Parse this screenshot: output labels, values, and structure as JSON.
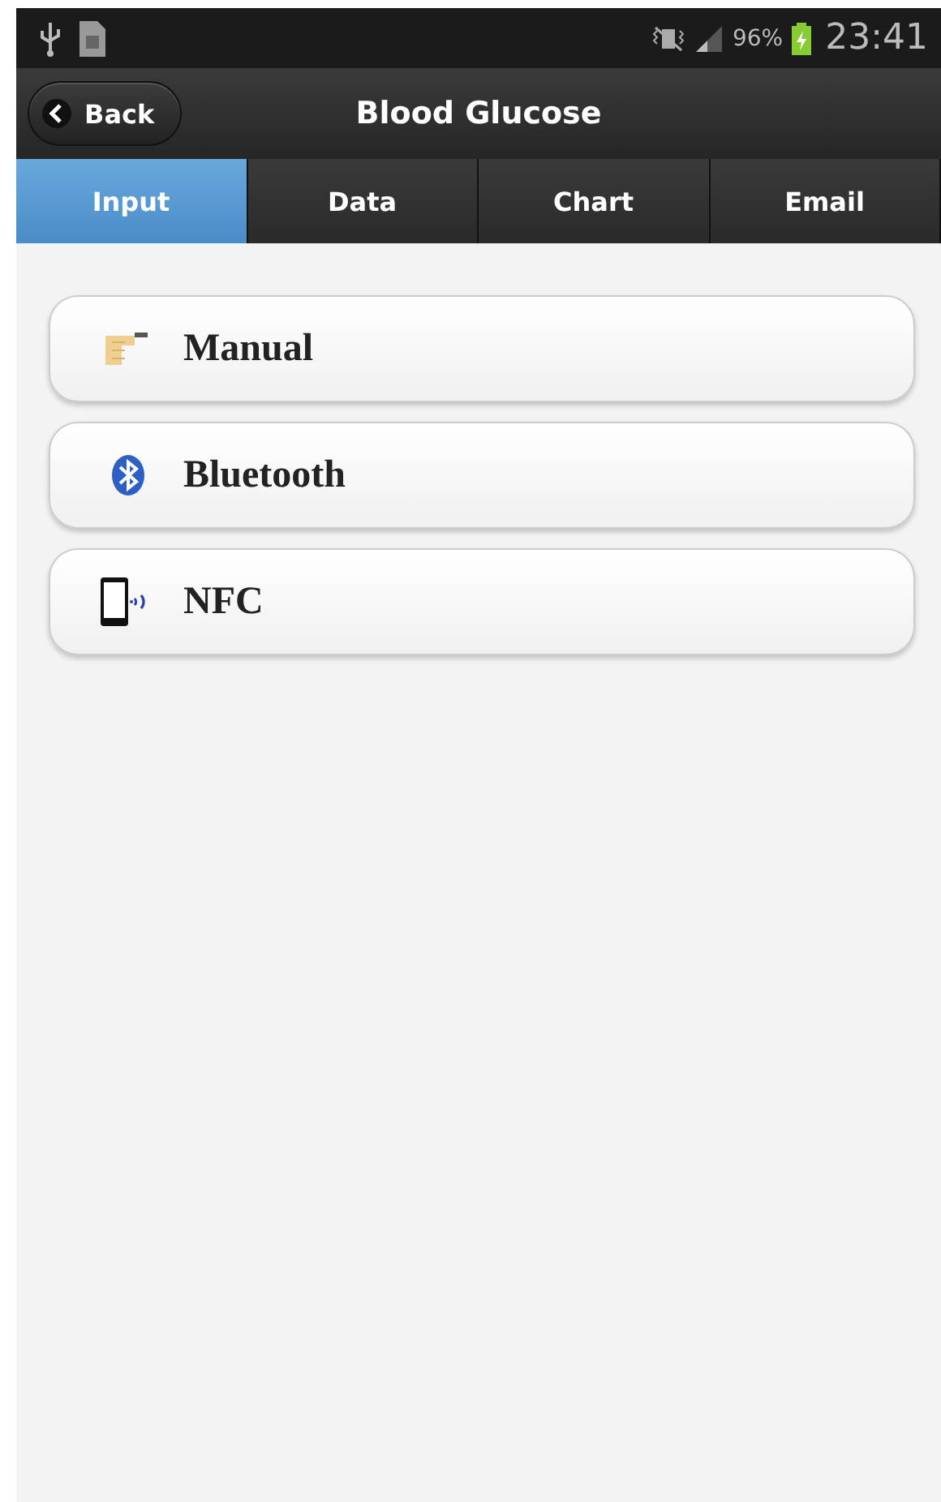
{
  "status_bar": {
    "battery": "96%",
    "time": "23:41"
  },
  "header": {
    "back_button": "Back",
    "title": "Blood Glucose"
  },
  "tabs": [
    {
      "label": "Input",
      "selected": true
    },
    {
      "label": "Data",
      "selected": false
    },
    {
      "label": "Chart",
      "selected": false
    },
    {
      "label": "Email",
      "selected": false
    }
  ],
  "input_options": [
    {
      "kind": "manual",
      "label": "Manual"
    },
    {
      "kind": "bluetooth",
      "label": "Bluetooth"
    },
    {
      "kind": "nfc",
      "label": "NFC"
    }
  ]
}
